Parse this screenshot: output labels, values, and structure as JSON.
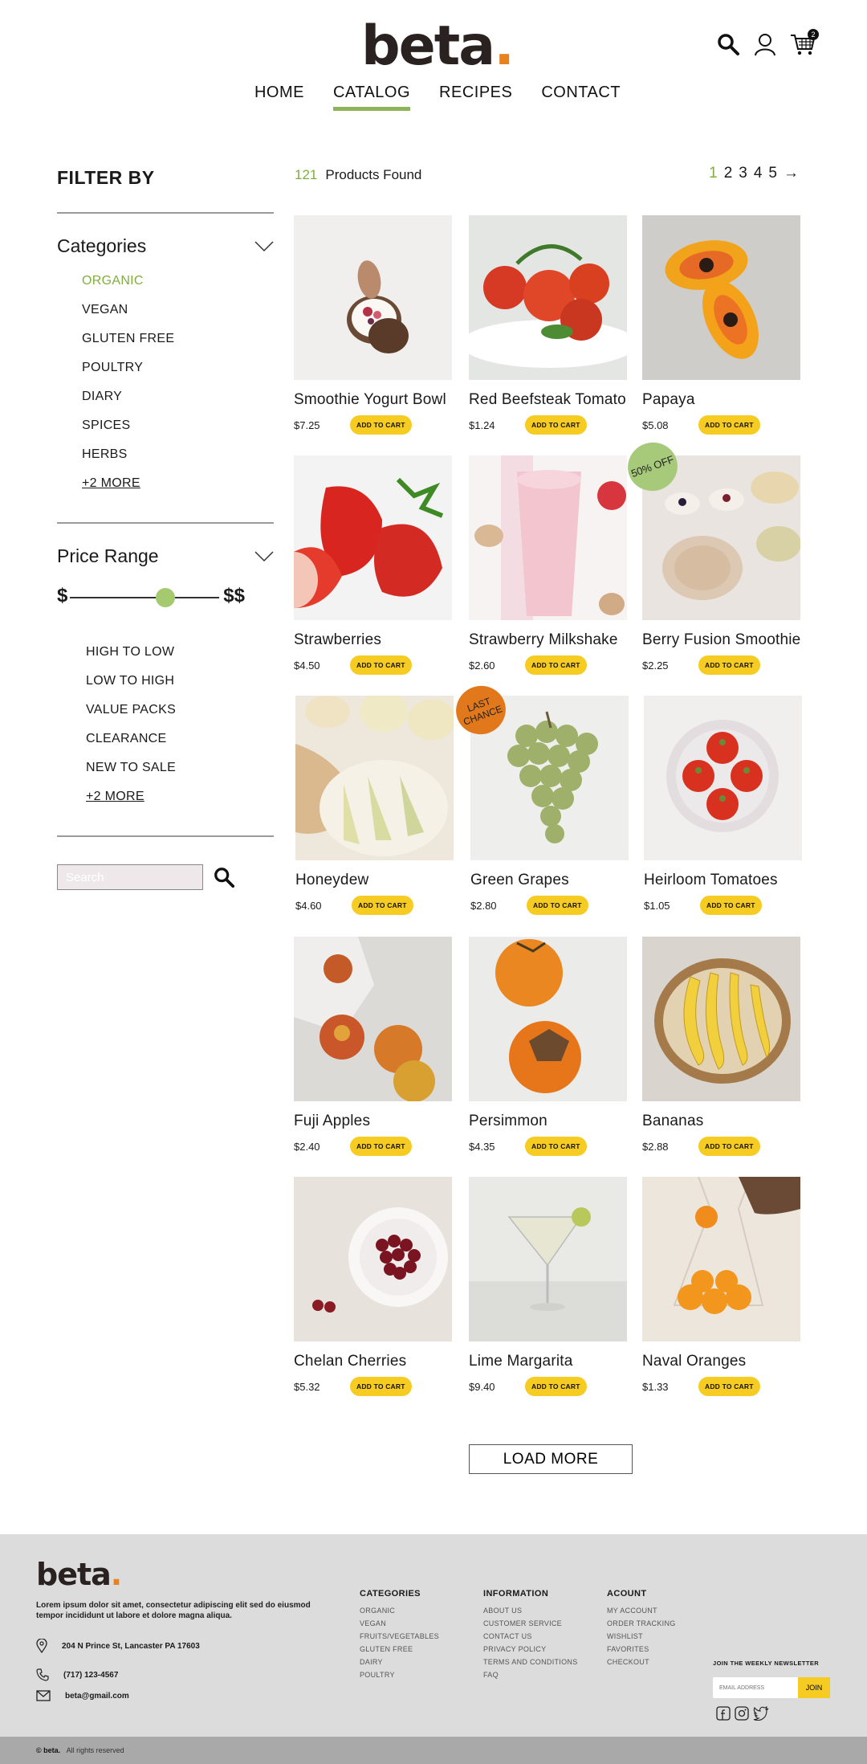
{
  "header": {
    "logo_text": "beta",
    "logo_dot": ".",
    "cart_count": "2",
    "icons": [
      "search-icon",
      "user-icon",
      "cart-icon"
    ],
    "nav": [
      "HOME",
      "CATALOG",
      "RECIPES",
      "CONTACT"
    ],
    "active_nav": "CATALOG"
  },
  "sidebar": {
    "filter_title": "FILTER BY",
    "categories_title": "Categories",
    "categories": [
      "ORGANIC",
      "VEGAN",
      "GLUTEN FREE",
      "POULTRY",
      "DIARY",
      "SPICES",
      "HERBS",
      "+2 MORE"
    ],
    "price_title": "Price Range",
    "price_min_label": "$",
    "price_max_label": "$$",
    "price_slider_position": 0.64,
    "sort_options": [
      "HIGH TO LOW",
      "LOW TO HIGH",
      "VALUE PACKS",
      "CLEARANCE",
      "NEW TO SALE",
      "+2 MORE"
    ],
    "search_placeholder": "Search"
  },
  "results": {
    "count": "121",
    "label": "Products Found",
    "pages": [
      "1",
      "2",
      "3",
      "4",
      "5"
    ],
    "next_arrow": "→"
  },
  "cart_button_label": "ADD TO CART",
  "products": [
    {
      "name": "Smoothie Yogurt Bowl",
      "price": "$7.25"
    },
    {
      "name": "Red Beefsteak Tomato",
      "price": "$1.24"
    },
    {
      "name": "Papaya",
      "price": "$5.08"
    },
    {
      "name": "Strawberries",
      "price": "$4.50"
    },
    {
      "name": "Strawberry Milkshake",
      "price": "$2.60"
    },
    {
      "name": "Berry Fusion Smoothie",
      "price": "$2.25"
    },
    {
      "name": "Honeydew",
      "price": "$4.60"
    },
    {
      "name": "Green Grapes",
      "price": "$2.80"
    },
    {
      "name": "Heirloom Tomatoes",
      "price": "$1.05"
    },
    {
      "name": "Fuji Apples",
      "price": "$2.40"
    },
    {
      "name": "Persimmon",
      "price": "$4.35"
    },
    {
      "name": "Bananas",
      "price": "$2.88"
    },
    {
      "name": "Chelan Cherries",
      "price": "$5.32"
    },
    {
      "name": "Lime Margarita",
      "price": "$9.40"
    },
    {
      "name": "Naval Oranges",
      "price": "$1.33"
    }
  ],
  "badges": {
    "berry_fusion": "50% OFF",
    "green_grapes": "LAST CHANCE"
  },
  "load_more": "LOAD MORE",
  "footer": {
    "logo_text": "beta",
    "description": "Lorem ipsum dolor sit amet, consectetur adipiscing elit sed do eiusmod tempor incididunt ut labore et dolore magna aliqua.",
    "address": "204 N Prince St, Lancaster PA 17603",
    "phone": "(717) 123-4567",
    "email": "beta@gmail.com",
    "columns": [
      {
        "title": "CATEGORIES",
        "items": [
          "ORGANIC",
          "VEGAN",
          "FRUITS/VEGETABLES",
          "GLUTEN FREE",
          "DAIRY",
          "POULTRY"
        ]
      },
      {
        "title": "INFORMATION",
        "items": [
          "ABOUT US",
          "CUSTOMER SERVICE",
          "CONTACT US",
          "PRIVACY POLICY",
          "TERMS AND CONDITIONS",
          "FAQ"
        ]
      },
      {
        "title": "ACOUNT",
        "items": [
          "MY ACCOUNT",
          "ORDER TRACKING",
          "WISHLIST",
          "FAVORITES",
          "CHECKOUT"
        ]
      }
    ],
    "newsletter_title": "JOIN THE WEEKLY NEWSLETTER",
    "newsletter_placeholder": "EMAIL ADDRESS",
    "newsletter_button": "JOIN",
    "copyright_brand": "© beta.",
    "copyright_text": "All rights reserved"
  },
  "colors": {
    "accent_green": "#8db45a",
    "cart_yellow": "#f6cc22",
    "logo_orange": "#e8821e"
  }
}
